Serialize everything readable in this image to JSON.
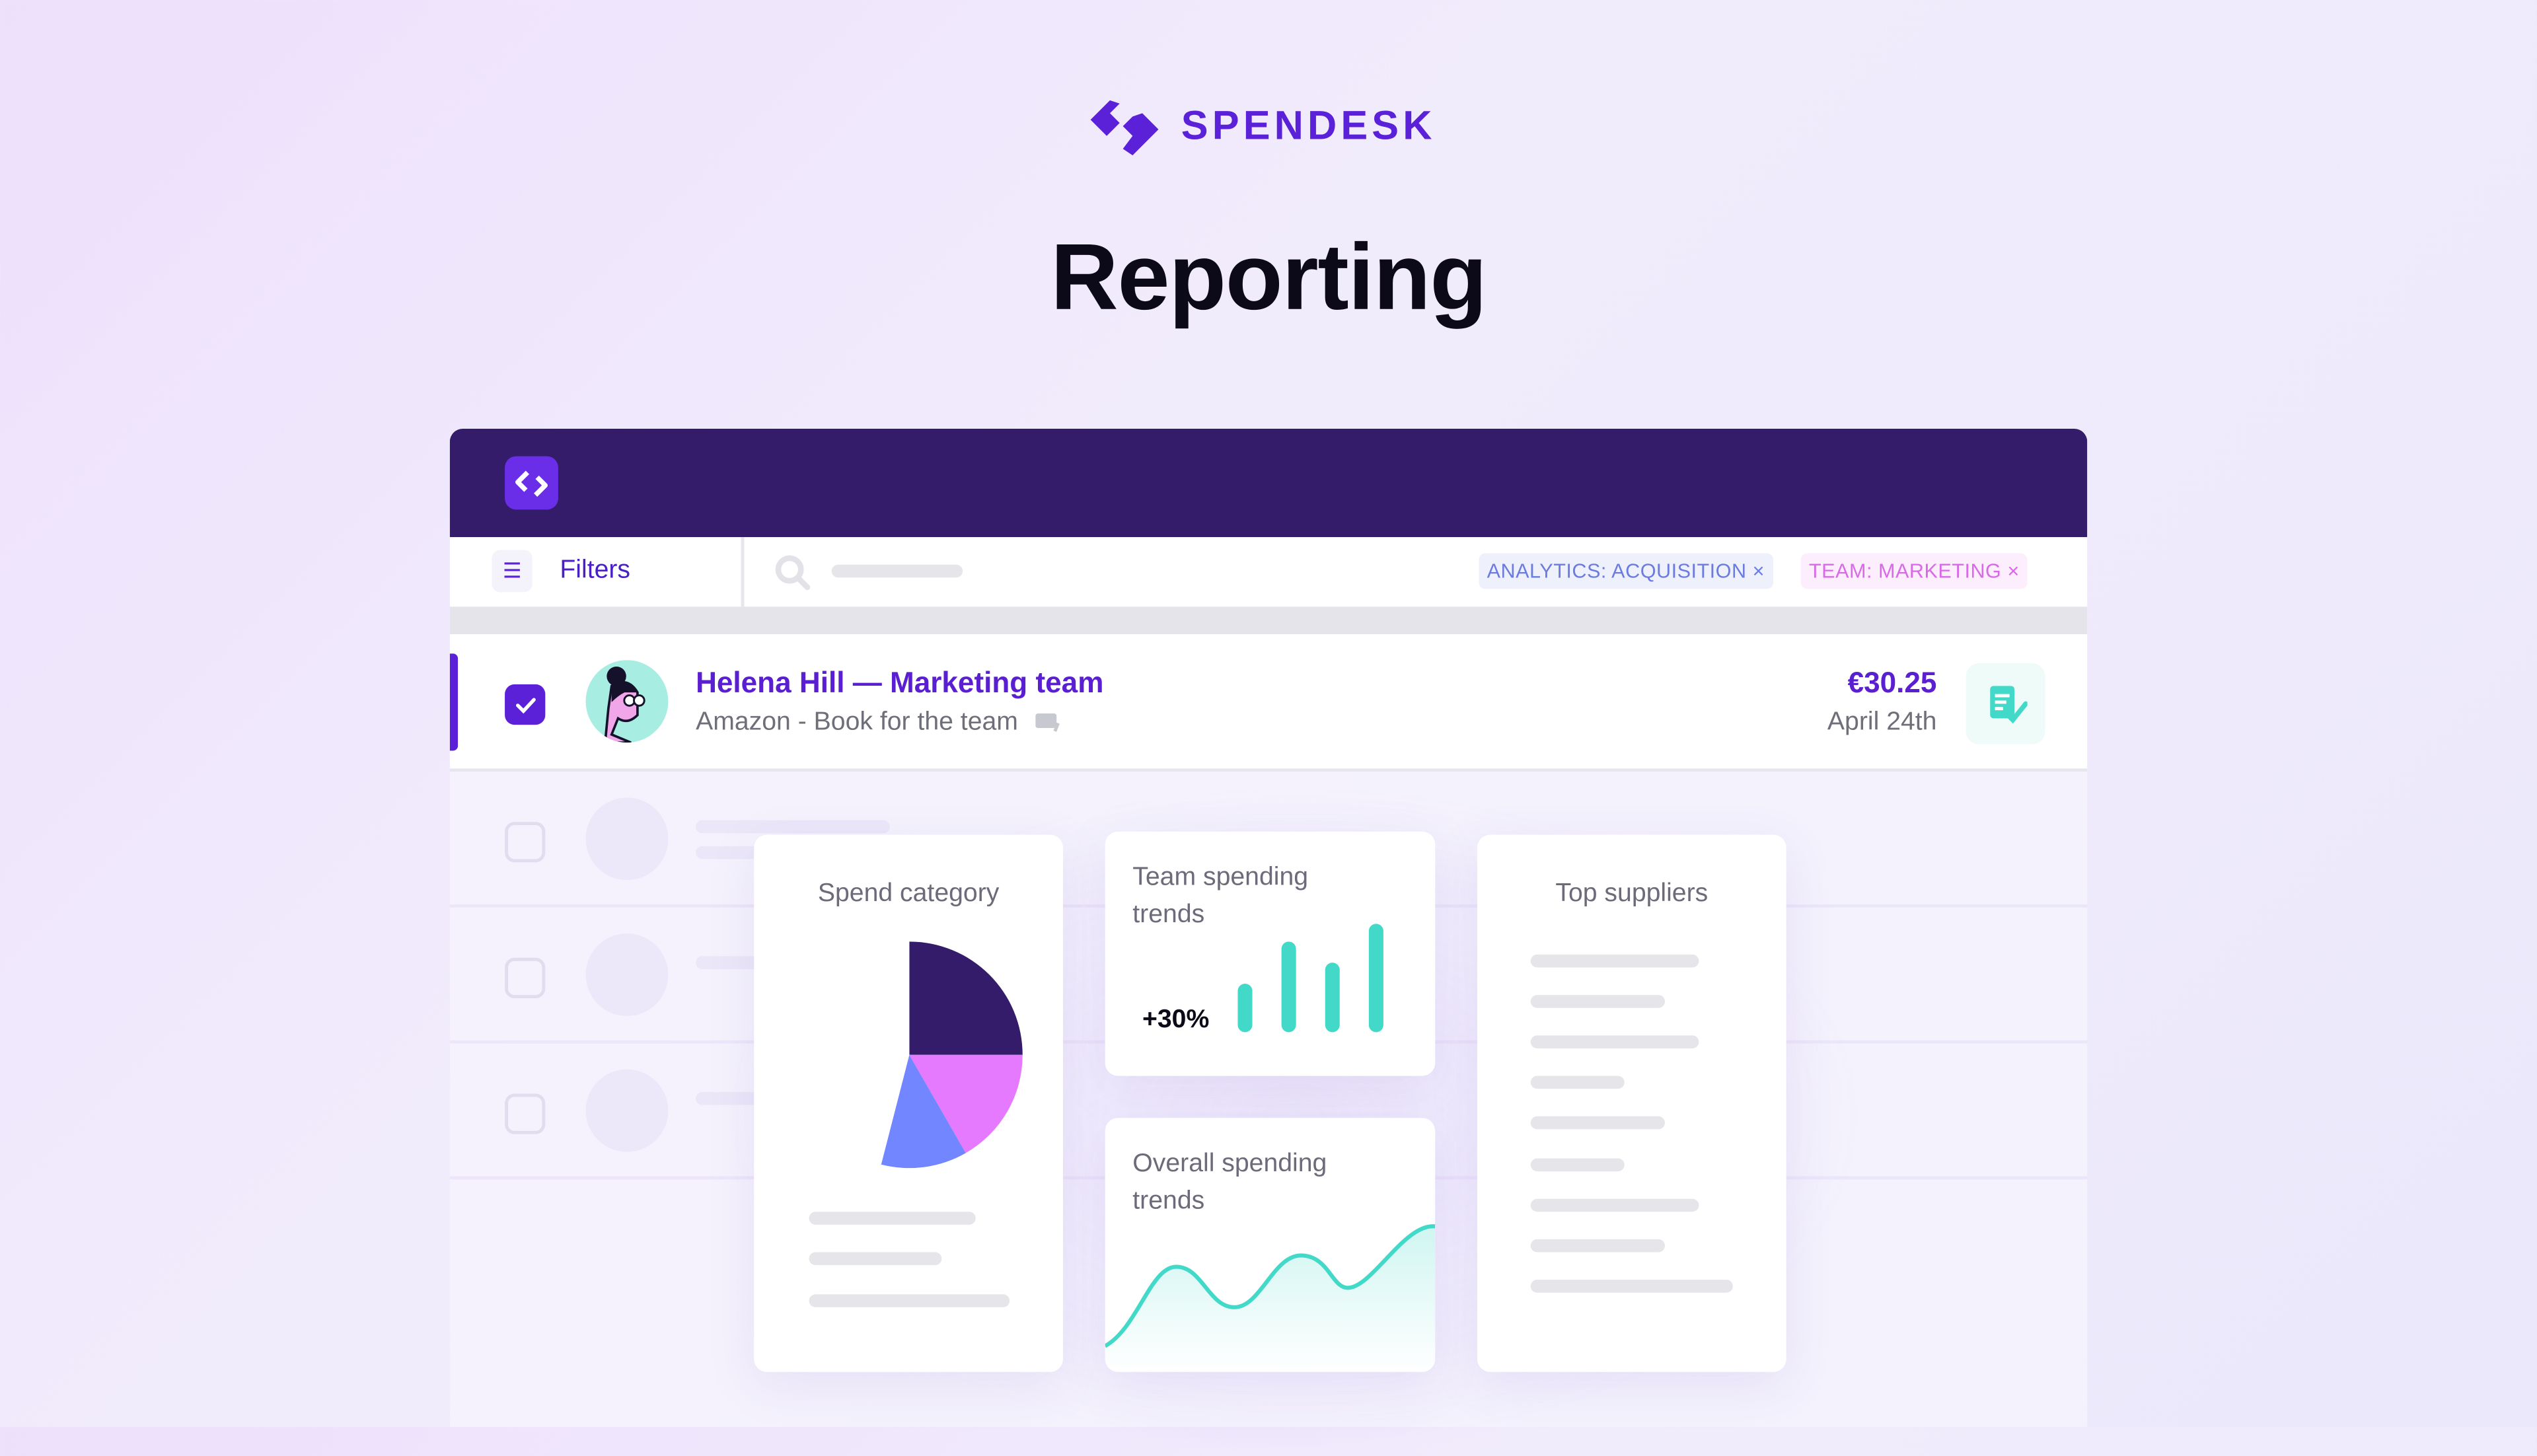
{
  "brand": {
    "name": "SPENDESK",
    "color": "#5b21d8",
    "icon": "spendesk-logo-icon"
  },
  "page": {
    "title": "Reporting"
  },
  "app": {
    "header_color": "#341c6a",
    "filters": {
      "label": "Filters",
      "icon": "sliders-icon",
      "search_icon": "search-icon"
    },
    "tags": [
      {
        "label": "ANALYTICS: ACQUISITION",
        "remove": "×",
        "color": "#6b7be0",
        "bg": "#eef0fb"
      },
      {
        "label": "TEAM: MARKETING",
        "remove": "×",
        "color": "#d86ae8",
        "bg": "#fdeefd"
      }
    ],
    "selected_row": {
      "checked": true,
      "title": "Helena Hill — Marketing team",
      "subtitle": "Amazon - Book for the team",
      "amount": "€30.25",
      "date": "April 24th",
      "receipt_icon": "receipt-check-icon",
      "card_icon": "card-icon"
    }
  },
  "cards": {
    "spend_category": {
      "title": "Spend category",
      "chart_data": {
        "type": "pie",
        "values": [
          25,
          16.7,
          12.3,
          46
        ],
        "colors": [
          "#341c6a",
          "#e57aff",
          "#7186ff",
          "#ffffff"
        ]
      }
    },
    "team_trends": {
      "title": "Team spending trends",
      "change": "+30%",
      "chart_data": {
        "type": "bar",
        "values": [
          30,
          56,
          43,
          67
        ],
        "color": "#43d9c9"
      }
    },
    "overall_trends": {
      "title": "Overall spending trends",
      "chart_data": {
        "type": "area",
        "color": "#43d9c9"
      }
    },
    "top_suppliers": {
      "title": "Top suppliers"
    }
  }
}
